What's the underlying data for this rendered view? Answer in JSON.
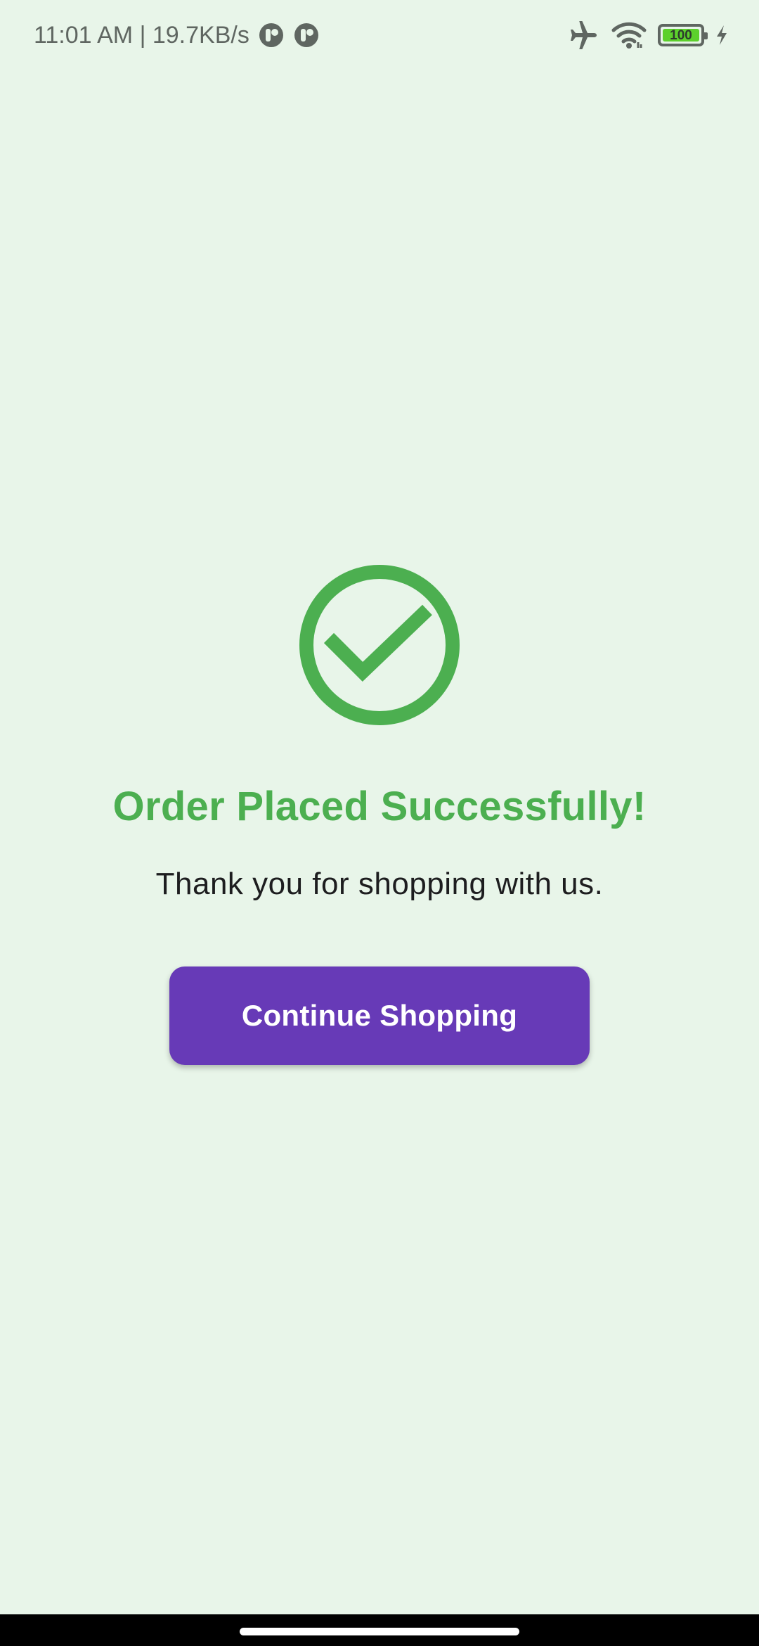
{
  "status_bar": {
    "time_speed": "11:01 AM | 19.7KB/s",
    "battery_level": "100",
    "battery_percent": 100,
    "icons": [
      "notification-app-icon",
      "notification-app-icon",
      "airplane-mode-icon",
      "wifi-icon",
      "battery-icon",
      "charging-bolt-icon"
    ]
  },
  "main": {
    "icon": "check-circle-icon",
    "title": "Order Placed Successfully!",
    "subtitle": "Thank you for shopping with us.",
    "button_label": "Continue Shopping"
  },
  "colors": {
    "background": "#e8f5e9",
    "success_green": "#4caf50",
    "button_purple": "#673ab7",
    "button_text": "#ffffff",
    "body_text": "#1d1d1f",
    "status_icons": "#5f6661",
    "battery_fill": "#5cd02c",
    "nav_bar": "#000000"
  }
}
